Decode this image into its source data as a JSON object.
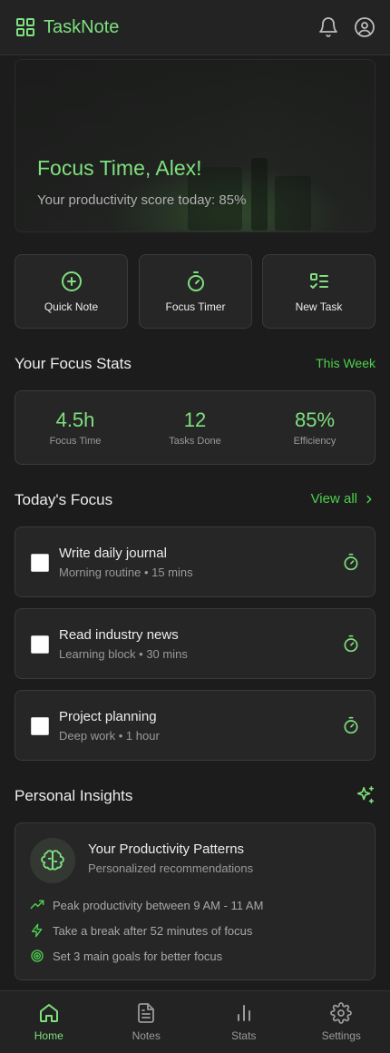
{
  "app": {
    "name": "TaskNote"
  },
  "colors": {
    "accent": "#7ee07e",
    "accent_link": "#4dd04d",
    "background": "#1c1c1c",
    "card": "#262626"
  },
  "header": {
    "icons": [
      "grid-icon",
      "bell-icon",
      "user-circle-icon"
    ]
  },
  "hero": {
    "title": "Focus Time, Alex!",
    "subtitle": "Your productivity score today: 85%"
  },
  "quick_actions": [
    {
      "label": "Quick Note",
      "icon": "plus-circle-icon"
    },
    {
      "label": "Focus Timer",
      "icon": "timer-icon"
    },
    {
      "label": "New Task",
      "icon": "checklist-icon"
    }
  ],
  "focus_stats": {
    "title": "Your Focus Stats",
    "period": "This Week",
    "items": [
      {
        "value": "4.5h",
        "label": "Focus Time"
      },
      {
        "value": "12",
        "label": "Tasks Done"
      },
      {
        "value": "85%",
        "label": "Efficiency"
      }
    ]
  },
  "todays_focus": {
    "title": "Today's Focus",
    "view_all": "View all",
    "tasks": [
      {
        "title": "Write daily journal",
        "meta": "Morning routine • 15 mins",
        "done": false
      },
      {
        "title": "Read industry news",
        "meta": "Learning block • 30 mins",
        "done": false
      },
      {
        "title": "Project planning",
        "meta": "Deep work • 1 hour",
        "done": false
      }
    ]
  },
  "insights": {
    "title": "Personal Insights",
    "card_title": "Your Productivity Patterns",
    "card_subtitle": "Personalized recommendations",
    "rows": [
      {
        "text": "Peak productivity between 9 AM - 11 AM",
        "icon": "trending-up-icon"
      },
      {
        "text": "Take a break after 52 minutes of focus",
        "icon": "lightning-icon"
      },
      {
        "text": "Set 3 main goals for better focus",
        "icon": "target-icon"
      }
    ]
  },
  "nav": {
    "items": [
      {
        "label": "Home",
        "icon": "home-icon",
        "active": true
      },
      {
        "label": "Notes",
        "icon": "document-icon",
        "active": false
      },
      {
        "label": "Stats",
        "icon": "bar-chart-icon",
        "active": false
      },
      {
        "label": "Settings",
        "icon": "gear-icon",
        "active": false
      }
    ]
  }
}
